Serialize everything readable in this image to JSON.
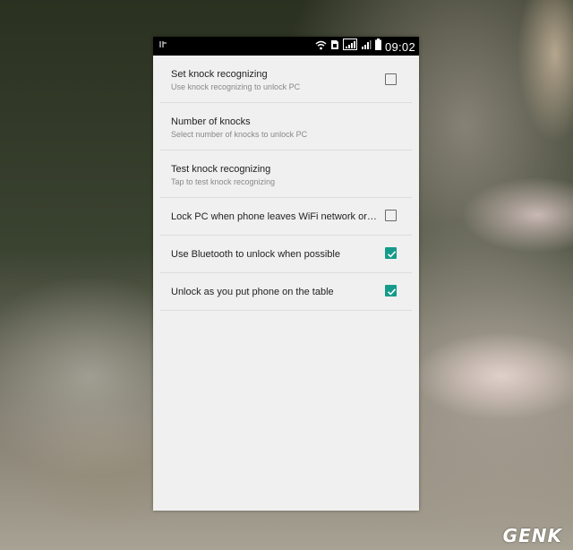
{
  "statusbar": {
    "left_icon": "usb-debug-icon",
    "icons": [
      "wifi-icon",
      "sim-icon",
      "signal-icon",
      "signal-icon",
      "battery-icon"
    ],
    "time": "09:02"
  },
  "settings": {
    "items": [
      {
        "title": "Set knock recognizing",
        "subtitle": "Use knock recognizing to unlock PC",
        "checkbox": true,
        "checked": false
      },
      {
        "title": "Number of knocks",
        "subtitle": "Select number of knocks to unlock PC",
        "checkbox": false
      },
      {
        "title": "Test knock recognizing",
        "subtitle": "Tap to test knock recognizing",
        "checkbox": false
      },
      {
        "title": "Lock PC when phone leaves WiFi network or B...",
        "checkbox": true,
        "checked": false
      },
      {
        "title": "Use Bluetooth to unlock when possible",
        "checkbox": true,
        "checked": true
      },
      {
        "title": "Unlock as you put phone on the table",
        "checkbox": true,
        "checked": true
      }
    ]
  },
  "accent_color": "#169b8a",
  "watermark": "GENK"
}
